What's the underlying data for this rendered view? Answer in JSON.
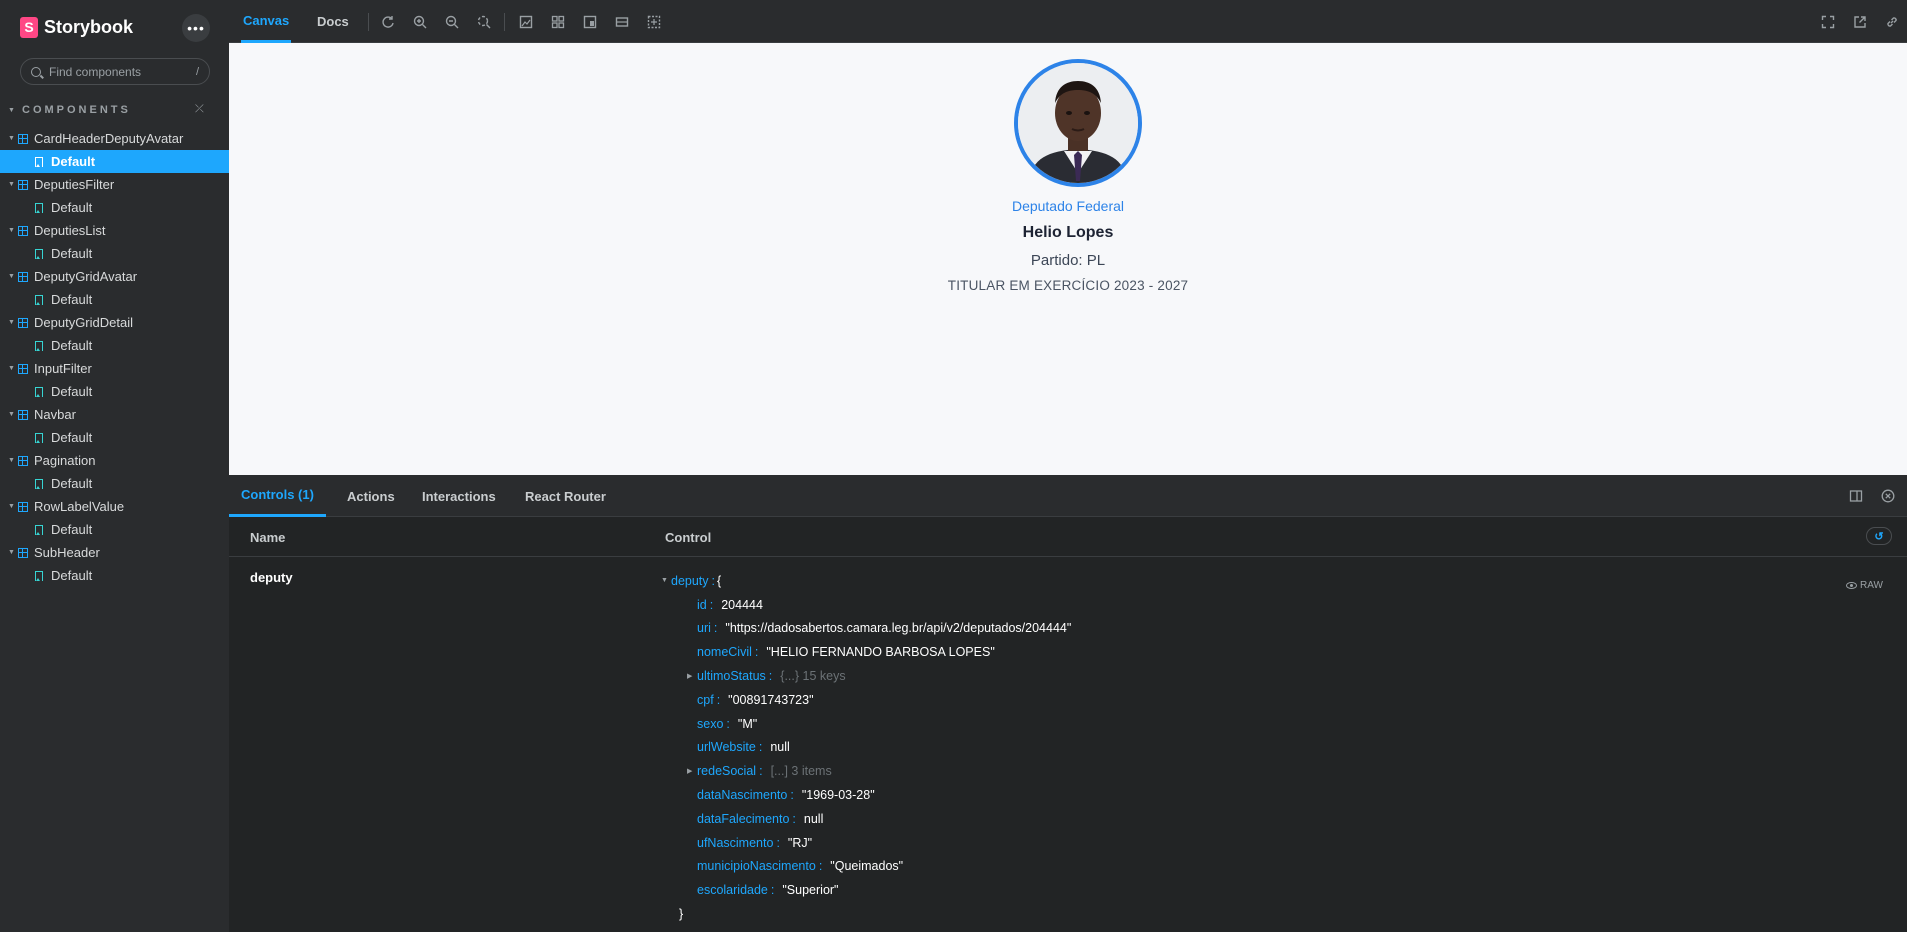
{
  "sidebar": {
    "brand": "Storybook",
    "menu_label": "•••",
    "search_placeholder": "Find components",
    "search_shortcut": "/",
    "section_title": "COMPONENTS",
    "collapse_symbol": "⤫",
    "components": [
      {
        "name": "CardHeaderDeputyAvatar",
        "story": "Default",
        "active": true
      },
      {
        "name": "DeputiesFilter",
        "story": "Default"
      },
      {
        "name": "DeputiesList",
        "story": "Default"
      },
      {
        "name": "DeputyGridAvatar",
        "story": "Default"
      },
      {
        "name": "DeputyGridDetail",
        "story": "Default"
      },
      {
        "name": "InputFilter",
        "story": "Default"
      },
      {
        "name": "Navbar",
        "story": "Default"
      },
      {
        "name": "Pagination",
        "story": "Default"
      },
      {
        "name": "RowLabelValue",
        "story": "Default"
      },
      {
        "name": "SubHeader",
        "story": "Default"
      }
    ]
  },
  "toolbar": {
    "tabs": [
      "Canvas",
      "Docs"
    ],
    "active_tab": "Canvas",
    "tools": [
      "reload-icon",
      "zoom-in-icon",
      "zoom-out-icon",
      "zoom-reset-icon",
      "background-icon",
      "grid-icon",
      "viewport-icon",
      "measure-icon",
      "outline-icon"
    ],
    "right_tools": [
      "fullscreen-icon",
      "open-new-tab-icon",
      "copy-link-icon"
    ]
  },
  "card": {
    "role": "Deputado Federal",
    "name": "Helio Lopes",
    "party": "Partido: PL",
    "status": "TITULAR EM EXERCÍCIO 2023 - 2027",
    "accent": "#2d83e8"
  },
  "panel": {
    "tabs": [
      "Controls (1)",
      "Actions",
      "Interactions",
      "React Router"
    ],
    "active_tab": "Controls (1)",
    "header_name": "Name",
    "header_control": "Control",
    "reset_symbol": "↺",
    "prop_name": "deputy",
    "raw_label": "RAW",
    "json_root_key": "deputy",
    "json_open": "{",
    "json_close": "}",
    "fields": [
      {
        "key": "id",
        "value": "204444"
      },
      {
        "key": "uri",
        "value": "\"https://dadosabertos.camara.leg.br/api/v2/deputados/204444\""
      },
      {
        "key": "nomeCivil",
        "value": "\"HELIO FERNANDO BARBOSA LOPES\""
      },
      {
        "key": "ultimoStatus",
        "meta": "{...} 15 keys",
        "collapsed": true
      },
      {
        "key": "cpf",
        "value": "\"00891743723\""
      },
      {
        "key": "sexo",
        "value": "\"M\""
      },
      {
        "key": "urlWebsite",
        "value": "null"
      },
      {
        "key": "redeSocial",
        "meta": "[...] 3 items",
        "collapsed": true
      },
      {
        "key": "dataNascimento",
        "value": "\"1969-03-28\""
      },
      {
        "key": "dataFalecimento",
        "value": "null"
      },
      {
        "key": "ufNascimento",
        "value": "\"RJ\""
      },
      {
        "key": "municipioNascimento",
        "value": "\"Queimados\""
      },
      {
        "key": "escolaridade",
        "value": "\"Superior\""
      }
    ]
  },
  "colors": {
    "accent": "#1ea7fd",
    "sidebar_bg": "#2a2c2e",
    "canvas_bg": "#f7f8fa"
  }
}
